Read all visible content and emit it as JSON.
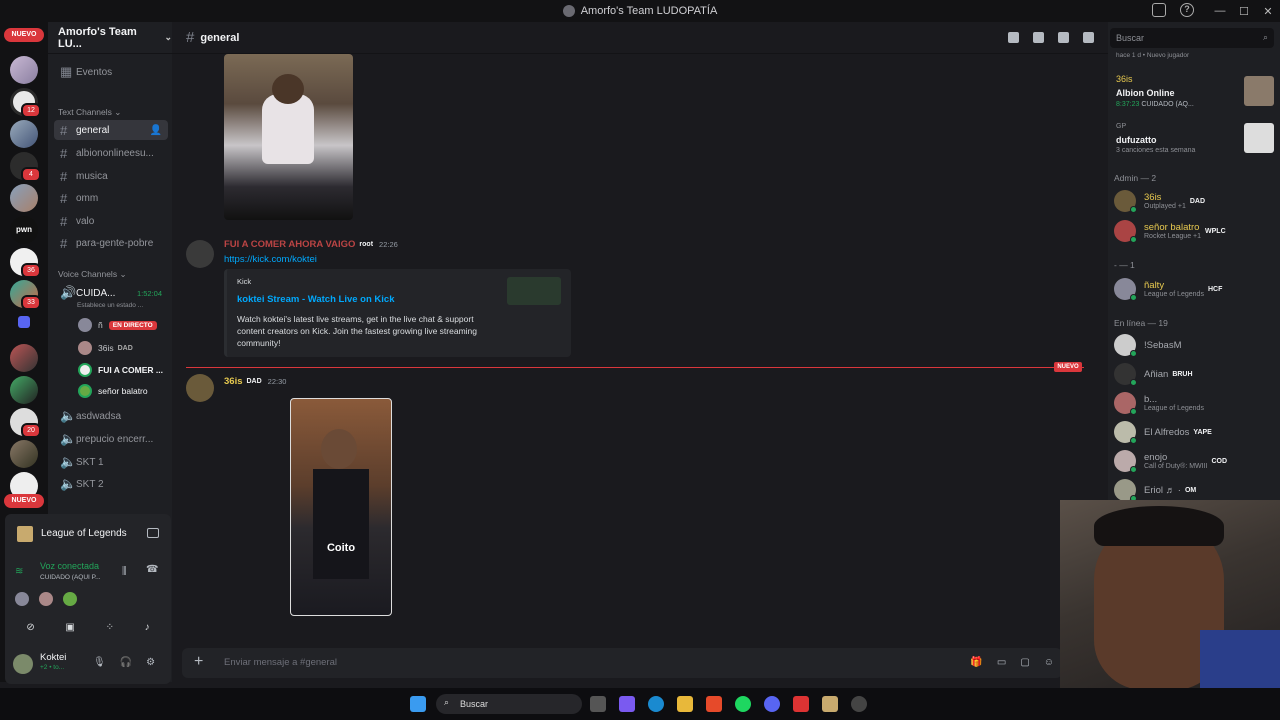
{
  "window": {
    "title": "Amorfo's Team LUDOPATÍA"
  },
  "server_bar": {
    "new_pill_top": "NUEVO",
    "new_pill_bottom": "NUEVO",
    "badges": [
      "2",
      "12",
      "4",
      "36",
      "33",
      "20"
    ]
  },
  "sidebar": {
    "server_name": "Amorfo's Team LU...",
    "events_label": "Eventos",
    "text_category": "Text Channels",
    "text_channels": [
      "general",
      "albiononlineesu...",
      "musica",
      "omm",
      "valo",
      "para-gente-pobre"
    ],
    "voice_category": "Voice Channels",
    "voice_channel": {
      "name": "CUIDA...",
      "timer": "1:52:04",
      "status": "Establece un estado ..."
    },
    "voice_users": [
      {
        "name": "ñ",
        "badge": "EN DIRECTO"
      },
      {
        "name": "36is",
        "tag": "DAD"
      },
      {
        "name": "FUI A COMER ..."
      },
      {
        "name": "señor balatro"
      }
    ],
    "other_voice": [
      "asdwadsa",
      "prepucio encerr...",
      "SKT 1",
      "SKT 2"
    ]
  },
  "activity_panel": {
    "game": "League of Legends",
    "voice_status": "Voz conectada",
    "voice_channel": "CUIDADO (AQUI P...",
    "username": "Koktei",
    "user_sub": "+2 • to..."
  },
  "channel": {
    "name": "general"
  },
  "messages": [
    {
      "author": "FUI A COMER AHORA VAIGO",
      "tag": "root",
      "time": "22:26",
      "link": "https://kick.com/koktei",
      "embed": {
        "provider": "Kick",
        "title": "koktei Stream - Watch Live on Kick",
        "description": "Watch koktei's latest live streams, get in the live chat & support content creators on Kick. Join the fastest growing live streaming community!"
      }
    },
    {
      "author": "36is",
      "tag": "DAD",
      "time": "22:30",
      "image_caption": "Coito"
    }
  ],
  "new_divider": "NUEVO",
  "composer": {
    "placeholder": "Enviar mensaje a #general"
  },
  "members": {
    "search_placeholder": "Buscar",
    "top_activity": [
      {
        "meta": "hace 1 d",
        "sub": "Nuevo jugador"
      },
      {
        "name": "36is",
        "game": "Albion Online",
        "time": "8:37:23",
        "extra": "CUIDADO (AQ..."
      },
      {
        "name": "GP",
        "song": "dufuzatto",
        "sub": "3 canciones esta semana"
      }
    ],
    "admin_category": "Admin — 2",
    "admins": [
      {
        "name": "36is",
        "tag": "DAD",
        "sub": "Outplayed +1"
      },
      {
        "name": "señor balatro",
        "tag": "WPLC",
        "sub": "Rocket League +1"
      }
    ],
    "dash_category": "- — 1",
    "dash_members": [
      {
        "name": "ñalty",
        "tag": "HCF",
        "sub": "League of Legends"
      }
    ],
    "online_category": "En línea — 19",
    "online": [
      {
        "name": "!SebasM",
        "tag": "",
        "sub": ""
      },
      {
        "name": "Añian",
        "tag": "BRUH",
        "sub": ""
      },
      {
        "name": "b...",
        "tag": "",
        "sub": "League of Legends"
      },
      {
        "name": "El Alfredos",
        "tag": "YAPE",
        "sub": ""
      },
      {
        "name": "enojo",
        "tag": "COD",
        "sub": "Call of Duty®: MWIII"
      },
      {
        "name": "Eriol ♬ ·",
        "tag": "OM",
        "sub": ""
      }
    ]
  },
  "taskbar": {
    "search": "Buscar"
  },
  "colors": {
    "accent_red": "#da373c",
    "online_green": "#23a55a",
    "link_blue": "#00a8fc",
    "gold": "#e7c94f"
  }
}
